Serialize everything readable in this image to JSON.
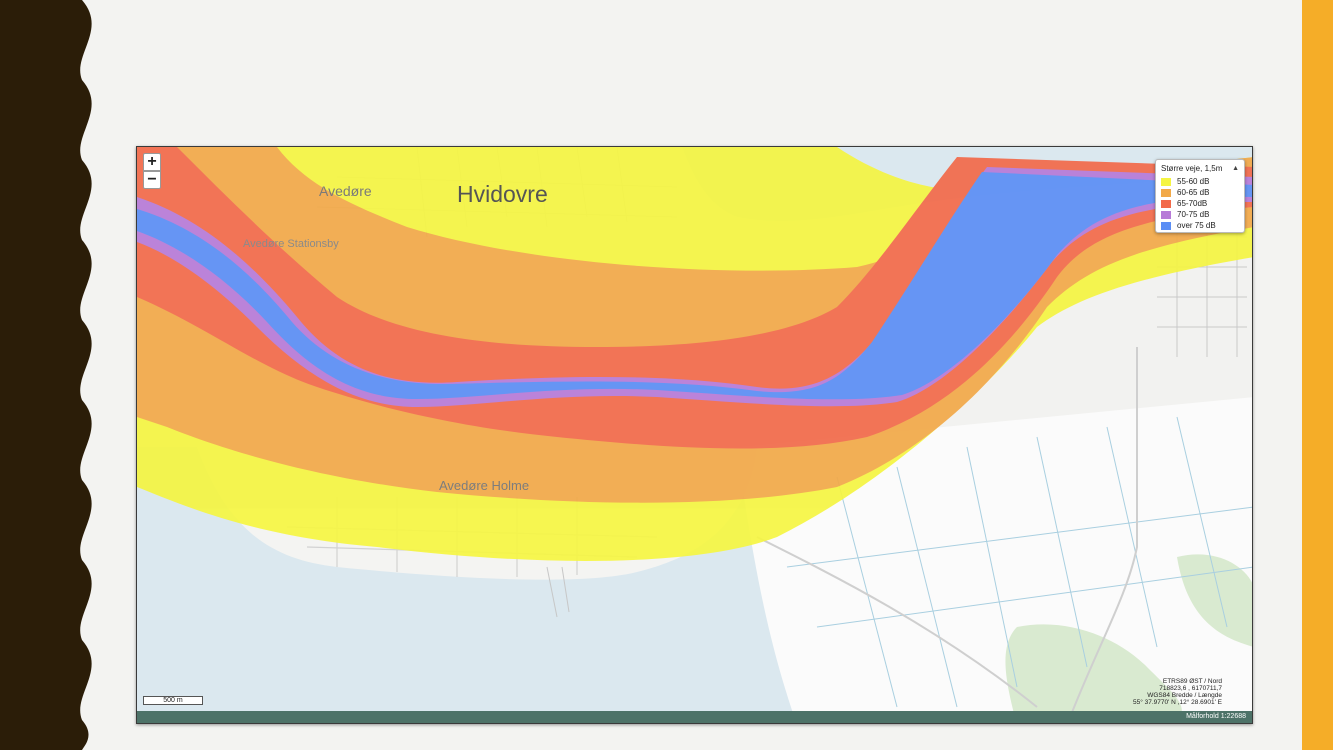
{
  "map": {
    "place_labels": {
      "hvidovre": "Hvidovre",
      "avedore": "Avedøre",
      "avedore_stationsby": "Avedøre Stationsby",
      "avedore_holme": "Avedøre Holme"
    },
    "controls": {
      "zoom_in": "+",
      "zoom_out": "−"
    },
    "legend": {
      "title": "Større veje, 1,5m",
      "caret": "▲",
      "items": [
        {
          "label": "55-60 dB",
          "color": "#f5f542"
        },
        {
          "label": "60-65 dB",
          "color": "#f2a948"
        },
        {
          "label": "65-70dB",
          "color": "#f26a4a"
        },
        {
          "label": "70-75 dB",
          "color": "#b77ad8"
        },
        {
          "label": "over 75 dB",
          "color": "#5b8ef5"
        }
      ]
    },
    "scale_bar": "500 m",
    "coordinates": {
      "line1": "ETRS89 ØST / Nord",
      "line2": "718823,6 , 6170711,7",
      "line3": "WGS84 Bredde / Længde",
      "line4": "55° 37.9770' N ,12° 28.6901' E"
    },
    "status_scale": "Målforhold 1:22688"
  },
  "colors": {
    "water": "#dbe8ef",
    "land": "#f2f2f0",
    "left_border": "#2b1d08",
    "accent_bar": "#f5ad28",
    "status_bar": "#4d7268"
  }
}
